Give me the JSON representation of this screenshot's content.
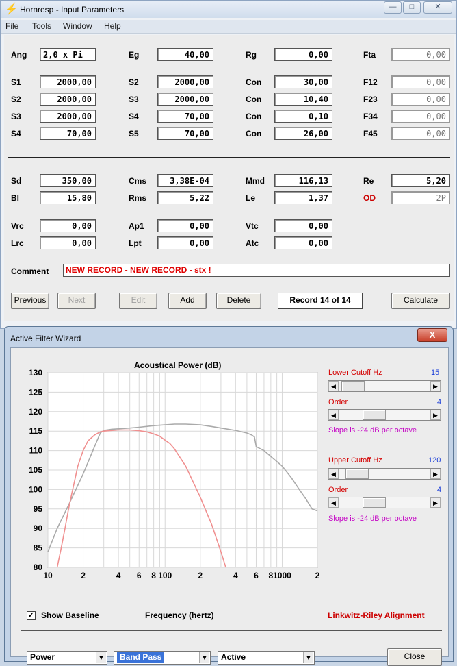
{
  "main": {
    "title": "Hornresp - Input Parameters",
    "menu": [
      "File",
      "Tools",
      "Window",
      "Help"
    ],
    "params": {
      "ang": {
        "label": "Ang",
        "value": "2,0 x Pi"
      },
      "eg": {
        "label": "Eg",
        "value": "40,00"
      },
      "rg": {
        "label": "Rg",
        "value": "0,00"
      },
      "fta": {
        "label": "Fta",
        "value": "0,00"
      },
      "s1": {
        "label": "S1",
        "value": "2000,00"
      },
      "s2a": {
        "label": "S2",
        "value": "2000,00"
      },
      "con1": {
        "label": "Con",
        "value": "30,00"
      },
      "f12": {
        "label": "F12",
        "value": "0,00"
      },
      "s2": {
        "label": "S2",
        "value": "2000,00"
      },
      "s3a": {
        "label": "S3",
        "value": "2000,00"
      },
      "con2": {
        "label": "Con",
        "value": "10,40"
      },
      "f23": {
        "label": "F23",
        "value": "0,00"
      },
      "s3": {
        "label": "S3",
        "value": "2000,00"
      },
      "s4a": {
        "label": "S4",
        "value": "70,00"
      },
      "con3": {
        "label": "Con",
        "value": "0,10"
      },
      "f34": {
        "label": "F34",
        "value": "0,00"
      },
      "s4": {
        "label": "S4",
        "value": "70,00"
      },
      "s5": {
        "label": "S5",
        "value": "70,00"
      },
      "con4": {
        "label": "Con",
        "value": "26,00"
      },
      "f45": {
        "label": "F45",
        "value": "0,00"
      },
      "sd": {
        "label": "Sd",
        "value": "350,00"
      },
      "cms": {
        "label": "Cms",
        "value": "3,38E-04"
      },
      "mmd": {
        "label": "Mmd",
        "value": "116,13"
      },
      "re": {
        "label": "Re",
        "value": "5,20"
      },
      "bl": {
        "label": "Bl",
        "value": "15,80"
      },
      "rms": {
        "label": "Rms",
        "value": "5,22"
      },
      "le": {
        "label": "Le",
        "value": "1,37"
      },
      "od": {
        "label": "OD",
        "value": "2P"
      },
      "vrc": {
        "label": "Vrc",
        "value": "0,00"
      },
      "ap1": {
        "label": "Ap1",
        "value": "0,00"
      },
      "vtc": {
        "label": "Vtc",
        "value": "0,00"
      },
      "lrc": {
        "label": "Lrc",
        "value": "0,00"
      },
      "lpt": {
        "label": "Lpt",
        "value": "0,00"
      },
      "atc": {
        "label": "Atc",
        "value": "0,00"
      }
    },
    "comment_label": "Comment",
    "comment": "NEW RECORD - NEW RECORD - stx !",
    "buttons": {
      "previous": "Previous",
      "next": "Next",
      "edit": "Edit",
      "add": "Add",
      "delete": "Delete",
      "calculate": "Calculate"
    },
    "record": "Record 14 of 14"
  },
  "wizard": {
    "title": "Active Filter Wizard",
    "close_glyph": "X",
    "show_baseline": "Show Baseline",
    "alignment": "Linkwitz-Riley Alignment",
    "lower_cutoff": {
      "label": "Lower Cutoff  Hz",
      "value": "15",
      "fraction": 0.04
    },
    "lower_order": {
      "label": "Order",
      "value": "4",
      "fraction": 0.35
    },
    "lower_slope": "Slope is -24 dB per octave",
    "upper_cutoff": {
      "label": "Upper Cutoff  Hz",
      "value": "120",
      "fraction": 0.1
    },
    "upper_order": {
      "label": "Order",
      "value": "4",
      "fraction": 0.35
    },
    "upper_slope": "Slope is -24 dB per octave",
    "selects": {
      "type": "Power",
      "filter": "Band Pass",
      "mode": "Active"
    },
    "close_button": "Close"
  },
  "chart_data": {
    "type": "line",
    "title": "Acoustical Power (dB)",
    "xlabel": "Frequency (hertz)",
    "x_scale": "log",
    "xlim": [
      10,
      2000
    ],
    "ylim": [
      80,
      130
    ],
    "yticks": [
      80,
      85,
      90,
      95,
      100,
      105,
      110,
      115,
      120,
      125,
      130
    ],
    "xtick_labels": [
      "10",
      "2",
      "4",
      "6",
      "8",
      "100",
      "2",
      "4",
      "6",
      "8",
      "1000",
      "2"
    ],
    "grid": true,
    "colors": {
      "baseline": "#aaaaaa",
      "filtered": "#f09090"
    },
    "series": [
      {
        "x": [
          10,
          12,
          15,
          20,
          25,
          28,
          30,
          35,
          40,
          50,
          60,
          80,
          100,
          120,
          150,
          200,
          250,
          300,
          400,
          500,
          550,
          580,
          600,
          700,
          800,
          1000,
          1200,
          1400,
          1600,
          1800,
          2000
        ],
        "y": [
          84,
          90,
          96,
          104,
          111,
          114.5,
          115.2,
          115.5,
          115.6,
          115.8,
          116.0,
          116.4,
          116.6,
          116.8,
          116.8,
          116.6,
          116.2,
          115.8,
          115.2,
          114.5,
          114.0,
          113.5,
          111.0,
          110.0,
          108.5,
          106.0,
          103.0,
          100.0,
          97.5,
          95.0,
          94.5
        ]
      },
      {
        "x": [
          12,
          13,
          14,
          15,
          16,
          18,
          20,
          22,
          25,
          28,
          30,
          40,
          50,
          60,
          70,
          80,
          90,
          100,
          110,
          120,
          150,
          200,
          250,
          300,
          330
        ],
        "y": [
          80,
          85,
          90,
          95,
          99,
          106,
          110,
          112.5,
          114,
          114.8,
          115.0,
          115.3,
          115.3,
          115.1,
          114.8,
          114.3,
          113.7,
          112.7,
          111.8,
          110.5,
          106.0,
          98.0,
          91.0,
          84.0,
          80.0
        ]
      }
    ]
  }
}
